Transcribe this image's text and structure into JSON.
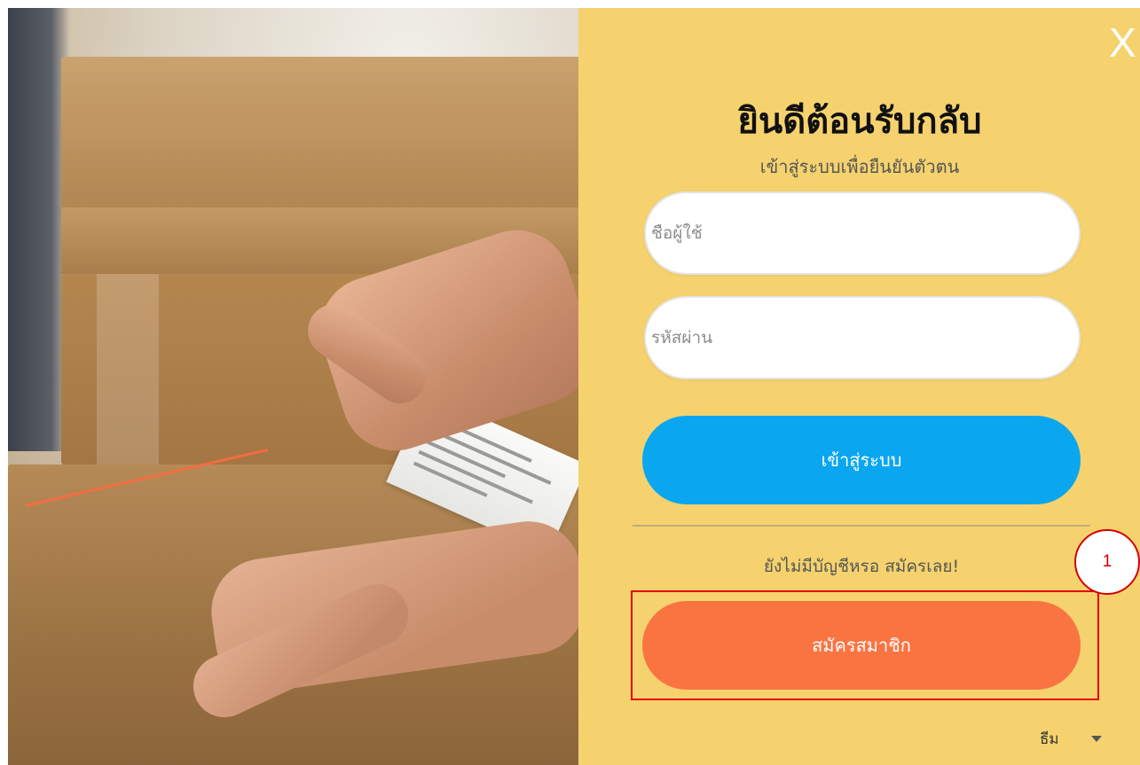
{
  "dialog": {
    "close_label": "X",
    "title": "ยินดีต้อนรับกลับ",
    "subtitle": "เข้าสู่ระบบเพื่อยืนยันตัวตน"
  },
  "form": {
    "username_placeholder": "ชื่อผู้ใช้",
    "username_value": "",
    "password_placeholder": "รหัสผ่าน",
    "password_value": "",
    "login_label": "เข้าสู่ระบบ"
  },
  "signup": {
    "prompt": "ยังไม่มีบัญชีหรอ สมัครเลย!",
    "button_label": "สมัครสมาชิก"
  },
  "annotation": {
    "step_number": "1"
  },
  "theme": {
    "label": "ธีม",
    "icon": "chevron-down-icon"
  },
  "colors": {
    "panel_bg": "#f5d26e",
    "login_button": "#0aa6f0",
    "signup_button": "#fa7442",
    "highlight": "#e60000"
  }
}
